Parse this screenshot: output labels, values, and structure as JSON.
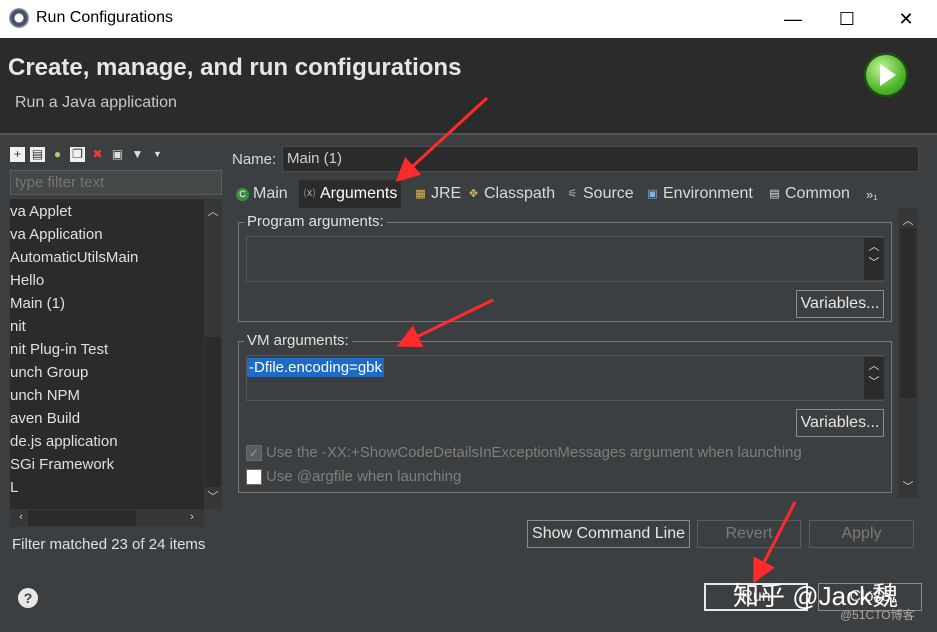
{
  "window": {
    "title": "Run Configurations",
    "minimize": "—",
    "maximize": "☐",
    "close": "✕"
  },
  "header": {
    "title": "Create, manage, and run configurations",
    "subtitle": "Run a Java application"
  },
  "left": {
    "filter_placeholder": "type filter text",
    "tree_items": [
      "va Applet",
      "va Application",
      " AutomaticUtilsMain",
      " Hello",
      " Main (1)",
      "nit",
      "nit Plug-in Test",
      "unch Group",
      "unch NPM",
      "aven Build",
      "de.js application",
      "SGi Framework",
      "L"
    ],
    "filter_status": "Filter matched 23 of 24 items"
  },
  "right": {
    "name_label": "Name:",
    "name_value": "Main (1)",
    "tabs": [
      "Main",
      "Arguments",
      "JRE",
      "Classpath",
      "Source",
      "Environment",
      "Common"
    ],
    "tabs_overflow": "»₁",
    "program_args_label": "Program arguments:",
    "program_args_value": "",
    "variables_label_1": "Variables...",
    "vm_args_label": "VM arguments:",
    "vm_args_value": "-Dfile.encoding=gbk",
    "variables_label_2": "Variables...",
    "chk_showcode": "Use the -XX:+ShowCodeDetailsInExceptionMessages argument when launching",
    "chk_argfile": "Use @argfile when launching",
    "show_cmd": "Show Command Line",
    "revert": "Revert",
    "apply": "Apply"
  },
  "bottom": {
    "help": "?",
    "run": "Run",
    "close": "Close",
    "watermark": "知乎 @Jack魏",
    "watermark2": "@51CTO博客"
  },
  "colors": {
    "annotation": "#ff2a2a",
    "selection": "#1e6bc5"
  }
}
